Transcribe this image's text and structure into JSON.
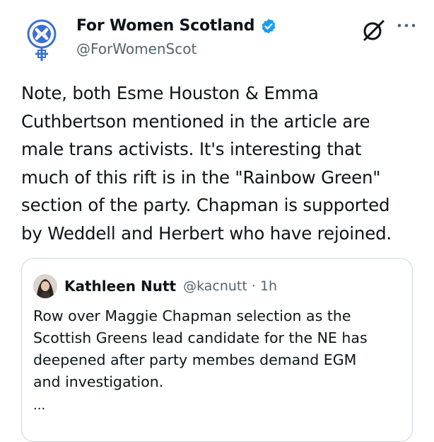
{
  "author": {
    "name": "For Women Scotland",
    "handle": "@ForWomenScot",
    "avatar_icon": "for-women-scotland-logo",
    "verified_icon": "verified-badge-icon"
  },
  "header_actions": {
    "grok_icon": "grok-icon",
    "more_icon": "more-options-icon"
  },
  "tweet": {
    "lines": [
      "Note, both Esme Houston & Emma",
      "Cuthbertson mentioned in the article are",
      "male trans activists. It's interesting that",
      "much of this rift is in the \"Rainbow Green\"",
      "section of the party. Chapman is supported",
      "by Weddell and Herbert who have rejoined."
    ]
  },
  "quoted": {
    "name": "Kathleen Nutt",
    "handle_time": "@kacnutt · 1h",
    "lines": [
      "Row over Maggie Chapman selection as the",
      "Scottish Greens lead candidate for the NE has",
      "deepened after party membes demand EGM",
      "and investigation."
    ],
    "ellipsis": "..."
  },
  "colors": {
    "text": "#0f1419",
    "secondary": "#536471",
    "verified": "#1d9bf0",
    "border": "#cfd9de",
    "logo_blue": "#3b6fd4"
  }
}
